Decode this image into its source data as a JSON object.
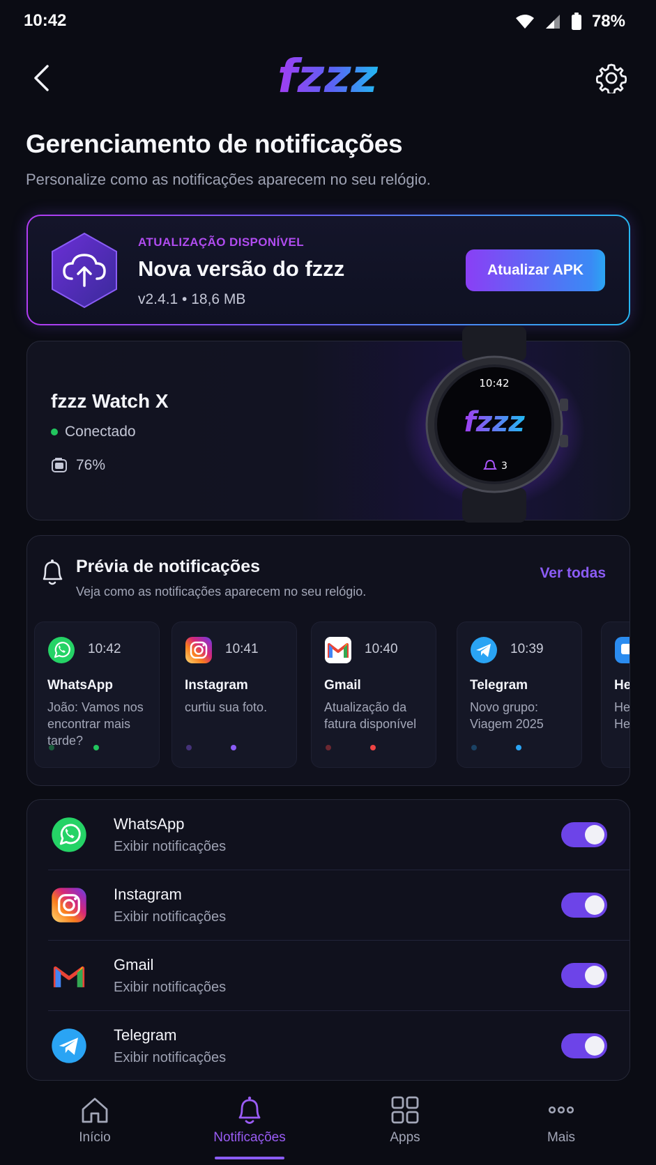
{
  "status_bar": {
    "time": "10:42",
    "battery": "78%"
  },
  "header": {
    "logo_text": "fzzz"
  },
  "page": {
    "title": "Gerenciamento de notificações",
    "subtitle": "Personalize como as notificações aparecem no seu relógio."
  },
  "update": {
    "eyebrow": "ATUALIZAÇÃO DISPONÍVEL",
    "title": "Nova versão do fzzz",
    "meta": "v2.4.1  •  18,6 MB",
    "button_label": "Atualizar APK"
  },
  "watch": {
    "name": "fzzz Watch X",
    "status": "Conectado",
    "battery": "76%",
    "face_time": "10:42",
    "face_logo": "fzzz",
    "face_notification_count": "3"
  },
  "preview": {
    "title": "Prévia de notificações",
    "subtitle": "Veja como as notificações aparecem no seu relógio.",
    "see_all": "Ver todas",
    "cards": [
      {
        "app": "WhatsApp",
        "time": "10:42",
        "text": "João: Vamos nos encontrar mais tarde?",
        "icon": "whatsapp-icon",
        "accent": "#22c55e"
      },
      {
        "app": "Instagram",
        "time": "10:41",
        "text": "curtiu sua foto.",
        "icon": "instagram-icon",
        "accent": "#8b5cf6"
      },
      {
        "app": "Gmail",
        "time": "10:40",
        "text": "Atualização da fatura disponível",
        "icon": "gmail-icon",
        "accent": "#ef4444"
      },
      {
        "app": "Telegram",
        "time": "10:39",
        "text": "Novo grupo: Viagem 2025",
        "icon": "telegram-icon",
        "accent": "#2aa4f4"
      },
      {
        "app": "He",
        "time": "",
        "text": "He\nHe",
        "icon": "message-icon",
        "accent": "#2aa4f4"
      }
    ]
  },
  "apps": [
    {
      "name": "WhatsApp",
      "sub": "Exibir notificações",
      "icon": "whatsapp-icon",
      "enabled": true
    },
    {
      "name": "Instagram",
      "sub": "Exibir notificações",
      "icon": "instagram-icon",
      "enabled": true
    },
    {
      "name": "Gmail",
      "sub": "Exibir notificações",
      "icon": "gmail-icon",
      "enabled": true
    },
    {
      "name": "Telegram",
      "sub": "Exibir notificações",
      "icon": "telegram-icon",
      "enabled": true
    }
  ],
  "nav": [
    {
      "label": "Início",
      "icon": "home-icon",
      "active": false
    },
    {
      "label": "Notificações",
      "icon": "bell-icon",
      "active": true
    },
    {
      "label": "Apps",
      "icon": "apps-grid-icon",
      "active": false
    },
    {
      "label": "Mais",
      "icon": "more-icon",
      "active": false
    }
  ],
  "colors": {
    "background": "#0b0c14",
    "accent_purple": "#8b5cf6",
    "accent_blue": "#2aa4f4",
    "connected_green": "#22c55e"
  }
}
